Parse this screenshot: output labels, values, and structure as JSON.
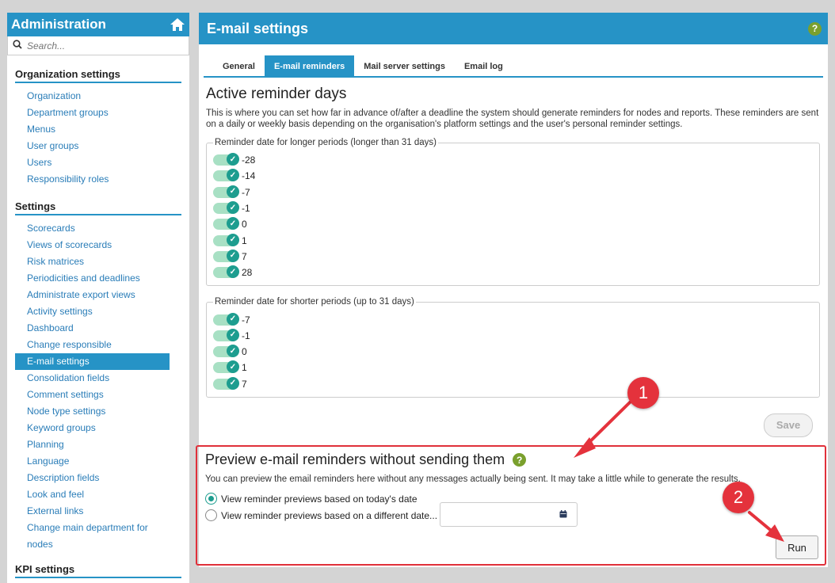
{
  "sidebar": {
    "title": "Administration",
    "search_placeholder": "Search...",
    "sections": [
      {
        "heading": "Organization settings",
        "items": [
          "Organization",
          "Department groups",
          "Menus",
          "User groups",
          "Users",
          "Responsibility roles"
        ]
      },
      {
        "heading": "Settings",
        "items": [
          "Scorecards",
          "Views of scorecards",
          "Risk matrices",
          "Periodicities and deadlines",
          "Administrate export views",
          "Activity settings",
          "Dashboard",
          "Change responsible",
          "E-mail settings",
          "Consolidation fields",
          "Comment settings",
          "Node type settings",
          "Keyword groups",
          "Planning",
          "Language",
          "Description fields",
          "Look and feel",
          "External links",
          "Change main department for",
          "nodes"
        ]
      },
      {
        "heading": "KPI settings",
        "items": []
      }
    ],
    "active_item": "E-mail settings"
  },
  "main": {
    "title": "E-mail settings",
    "help": "?",
    "tabs": [
      "General",
      "E-mail reminders",
      "Mail server settings",
      "Email log"
    ],
    "active_tab": "E-mail reminders",
    "active_heading": "Active reminder days",
    "active_description": "This is where you can set how far in advance of/after a deadline the system should generate reminders for nodes and reports. These reminders are sent on a daily or weekly basis depending on the organisation's platform settings and the user's personal reminder settings.",
    "longer": {
      "legend": "Reminder date for longer periods (longer than 31 days)",
      "days": [
        "-28",
        "-14",
        "-7",
        "-1",
        "0",
        "1",
        "7",
        "28"
      ]
    },
    "shorter": {
      "legend": "Reminder date for shorter periods (up to 31 days)",
      "days": [
        "-7",
        "-1",
        "0",
        "1",
        "7"
      ]
    },
    "save_label": "Save",
    "preview": {
      "heading": "Preview e-mail reminders without sending them",
      "description": "You can preview the email reminders here without any messages actually being sent. It may take a little while to generate the results.",
      "option_today": "View reminder previews based on today's date",
      "option_other": "View reminder previews based on a different date...",
      "date_value": "",
      "run_label": "Run"
    }
  },
  "markers": [
    "1",
    "2"
  ],
  "colors": {
    "accent": "#2693c6",
    "toggle_on": "#1d9d8f",
    "annotation": "#e4323c",
    "help": "#7aa02d"
  }
}
